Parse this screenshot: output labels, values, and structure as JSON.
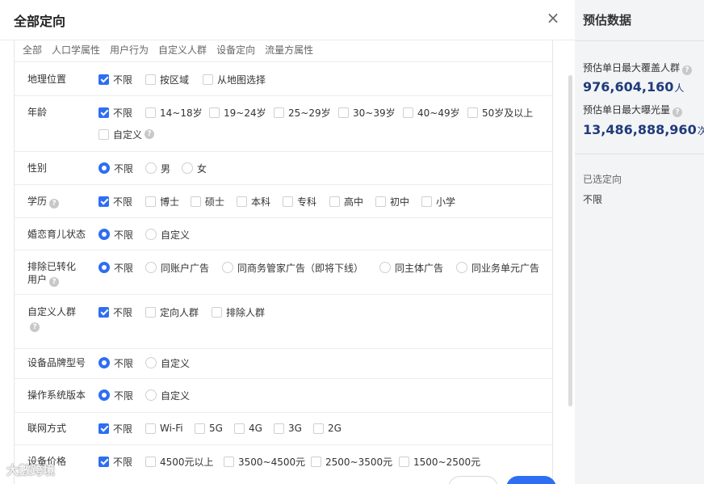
{
  "dialog": {
    "title": "全部定向",
    "close_symbol": "×"
  },
  "tabs": [
    "全部",
    "人口学属性",
    "用户行为",
    "自定义人群",
    "设备定向",
    "流量方属性"
  ],
  "rows": {
    "location": {
      "label": "地理位置",
      "options": [
        "不限",
        "按区域",
        "从地图选择"
      ]
    },
    "age": {
      "label": "年龄",
      "options": [
        "不限",
        "14~18岁",
        "19~24岁",
        "25~29岁",
        "30~39岁",
        "40~49岁",
        "50岁及以上",
        "自定义"
      ]
    },
    "gender": {
      "label": "性别",
      "options": [
        "不限",
        "男",
        "女"
      ]
    },
    "education": {
      "label": "学历",
      "options": [
        "不限",
        "博士",
        "硕士",
        "本科",
        "专科",
        "高中",
        "初中",
        "小学"
      ]
    },
    "marital": {
      "label": "婚恋育儿状态",
      "options": [
        "不限",
        "自定义"
      ]
    },
    "exclude": {
      "label_line1": "排除已转化",
      "label_line2": "用户",
      "options": [
        "不限",
        "同账户广告",
        "同商务管家广告（即将下线）",
        "同主体广告",
        "同业务单元广告"
      ]
    },
    "custom_audience": {
      "label": "自定义人群",
      "options": [
        "不限",
        "定向人群",
        "排除人群"
      ]
    },
    "device_brand": {
      "label": "设备品牌型号",
      "options": [
        "不限",
        "自定义"
      ]
    },
    "os_version": {
      "label": "操作系统版本",
      "options": [
        "不限",
        "自定义"
      ]
    },
    "network": {
      "label": "联网方式",
      "options": [
        "不限",
        "Wi-Fi",
        "5G",
        "4G",
        "3G",
        "2G"
      ]
    },
    "device_price": {
      "label": "设备价格",
      "options": [
        "不限",
        "4500元以上",
        "3500~4500元",
        "2500~3500元",
        "1500~2500元"
      ]
    }
  },
  "sidebar": {
    "title": "预估数据",
    "coverage_label": "预估单日最大覆盖人群",
    "coverage_value": "976,604,160",
    "coverage_unit": "人",
    "exposure_label": "预估单日最大曝光量",
    "exposure_value": "13,486,888,960",
    "exposure_unit": "次",
    "selected_label": "已选定向",
    "selected_value": "不限"
  },
  "watermark": "大數跨境",
  "colors": {
    "accent": "#2e6ef2",
    "value_text": "#1f3b7a"
  }
}
